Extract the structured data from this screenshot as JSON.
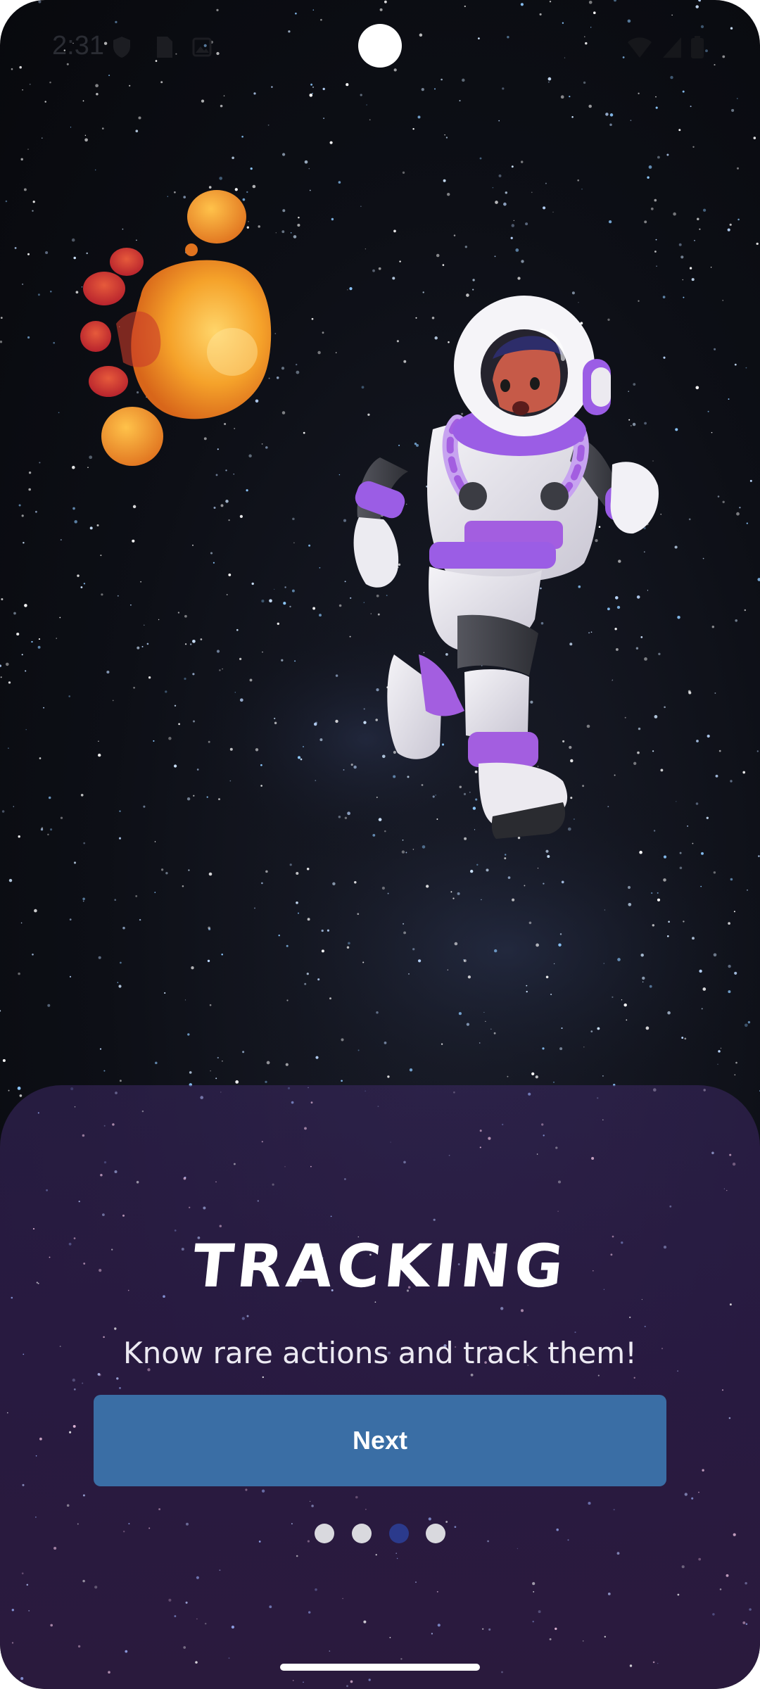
{
  "status_bar": {
    "time": "2:31",
    "icons": [
      "shield-icon",
      "sim-card-icon",
      "image-icon",
      "wifi-icon",
      "signal-icon",
      "battery-icon"
    ]
  },
  "onboarding": {
    "title": "TRACKING",
    "subtitle": "Know rare actions and track them!",
    "next_label": "Next",
    "pages": 4,
    "current_page": 3
  },
  "colors": {
    "button": "#3a6ea5",
    "dot_active": "#2b3a8c",
    "dot_inactive": "#d9d9de",
    "suit_accent": "#9b5de5"
  },
  "illustration": {
    "icons": [
      "planet-icon",
      "astronaut-icon"
    ]
  }
}
